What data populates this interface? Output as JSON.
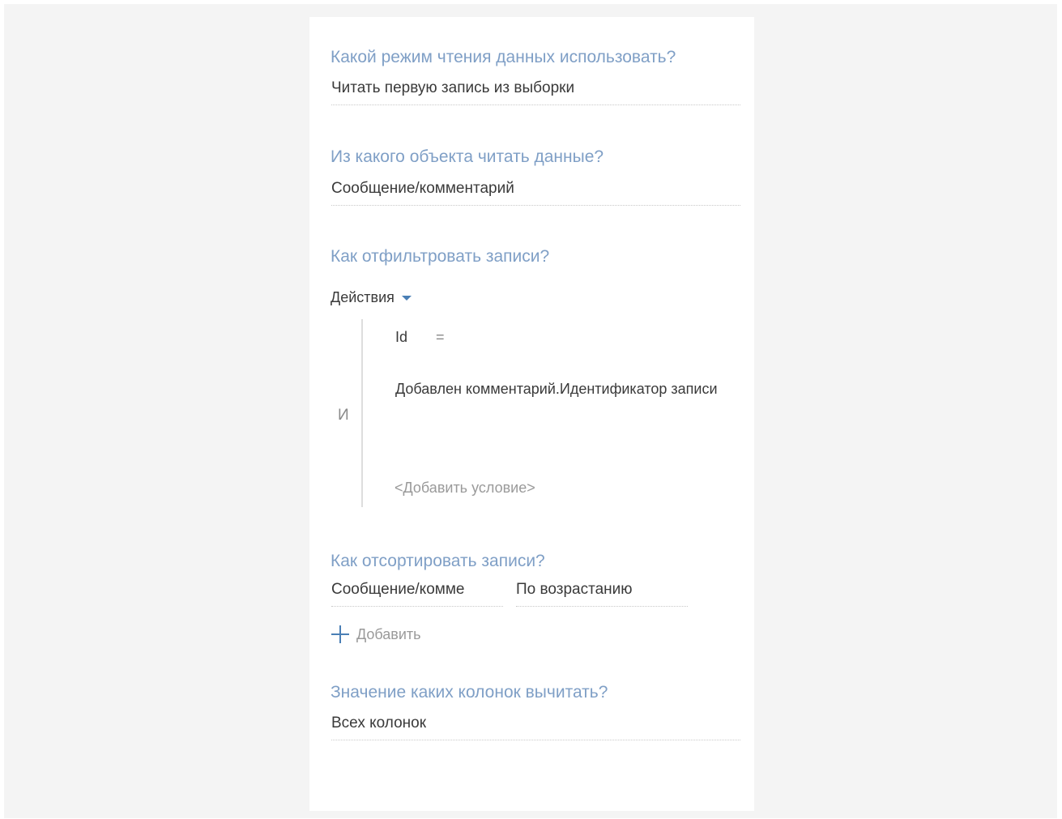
{
  "read_mode": {
    "question": "Какой режим чтения данных использовать?",
    "value": "Читать первую запись из выборки"
  },
  "source_object": {
    "question": "Из какого объекта читать данные?",
    "value": "Сообщение/комментарий"
  },
  "filter": {
    "question": "Как отфильтровать записи?",
    "actions_label": "Действия",
    "group_operator": "И",
    "condition": {
      "column": "Id",
      "operator": "=",
      "value": "Добавлен комментарий.Идентификатор записи"
    },
    "add_condition_label": "<Добавить условие>"
  },
  "sorting": {
    "question": "Как отсортировать записи?",
    "column_value": "Сообщение/комме",
    "direction_value": "По возрастанию",
    "add_label": "Добавить"
  },
  "columns": {
    "question": "Значение каких колонок вычитать?",
    "value": "Всех колонок"
  },
  "colors": {
    "question_text": "#7f9fc6",
    "accent": "#4a7fb5",
    "panel_background": "#ffffff",
    "page_background": "#f4f4f4"
  }
}
